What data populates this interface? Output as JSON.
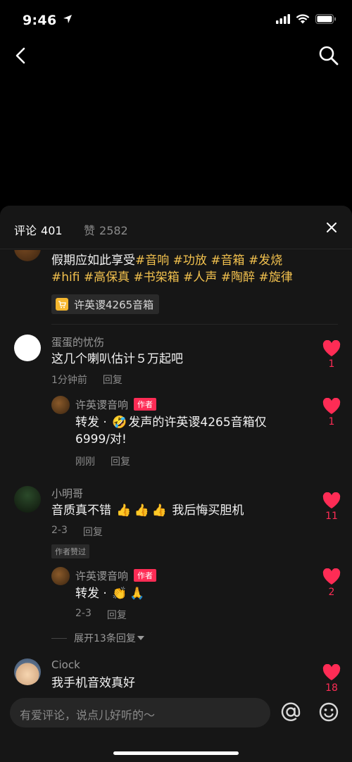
{
  "status": {
    "time": "9:46"
  },
  "tabs": {
    "comments": {
      "label": "评论",
      "count": "401"
    },
    "likes": {
      "label": "赞",
      "count": "2582"
    }
  },
  "first_comment": {
    "text": "假期应如此享受",
    "hashtags": [
      "#音响",
      "#功放",
      "#音箱",
      "#发烧",
      "#hifi",
      "#高保真",
      "#书架箱",
      "#人声",
      "#陶醉",
      "#旋律"
    ],
    "product_tag": "许英谡4265音箱"
  },
  "comments": [
    {
      "name": "蛋蛋的忧伤",
      "text": "这几个喇叭估计５万起吧",
      "time": "1分钟前",
      "reply": "回复",
      "likes": "1",
      "reply_item": {
        "name": "许英谡音响",
        "badge": "作者",
        "text_prefix": "转发 · ",
        "text_main": "发声的许英谡4265音箱仅",
        "text_line2": "6999/对!",
        "time": "刚刚",
        "reply": "回复",
        "likes": "1"
      }
    },
    {
      "name": "小明哥",
      "text_main": "音质真不错",
      "text_tail": "我后悔买胆机",
      "time": "2-3",
      "reply": "回复",
      "liked_tag": "作者赞过",
      "likes": "11",
      "reply_item": {
        "name": "许英谡音响",
        "badge": "作者",
        "text_prefix": "转发 · ",
        "time": "2-3",
        "reply": "回复",
        "likes": "2"
      },
      "expand": "展开13条回复"
    },
    {
      "name": "Ciock",
      "text": "我手机音效真好",
      "likes": "18"
    }
  ],
  "input": {
    "placeholder": "有爱评论，说点儿好听的～"
  },
  "colors": {
    "accent": "#fe2c55",
    "hashtag": "#f2c14e",
    "sheet": "#161616"
  }
}
